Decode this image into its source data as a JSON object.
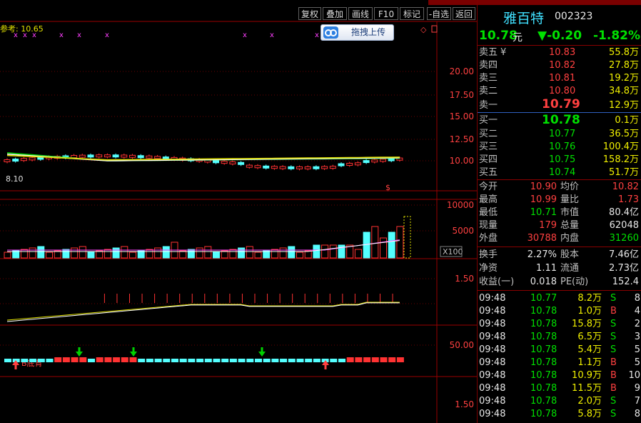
{
  "toolbar": {
    "buttons": [
      "复权",
      "叠加",
      "画线",
      "F10",
      "标记",
      "-自选",
      "返回"
    ]
  },
  "chart": {
    "ref_label": "参考: 10.65",
    "low_label": "8.10",
    "price_axis": [
      "20.00",
      "17.50",
      "15.00",
      "12.50",
      "10.00"
    ],
    "volume_axis": [
      "10000",
      "5000"
    ],
    "volume_unit": "X100",
    "ind1_axis": "1.50",
    "ind2_axis": "50.00",
    "ind2_label": "B底背",
    "ind3_axis": "1.50",
    "upload_label": "拖拽上传",
    "colors": {
      "up": "#ff3232",
      "down": "#54ffff",
      "ma_green": "#00d000",
      "ma_white": "#ffffff",
      "ma_yellow": "#e0e000",
      "ma_purple": "#ff40ff"
    }
  },
  "quote": {
    "name": "雅百特",
    "code": "002323",
    "price": "10.78",
    "price_unit": "元",
    "change": "▼-0.20",
    "change_pct": "-1.82%"
  },
  "order_book": {
    "sells": [
      {
        "label": "卖五",
        "flag": "¥",
        "price": "10.83",
        "vol": "55.8万"
      },
      {
        "label": "卖四",
        "price": "10.82",
        "vol": "27.8万"
      },
      {
        "label": "卖三",
        "price": "10.81",
        "vol": "19.2万"
      },
      {
        "label": "卖二",
        "price": "10.80",
        "vol": "34.8万"
      },
      {
        "label": "卖一",
        "price": "10.79",
        "vol": "12.9万"
      }
    ],
    "buys": [
      {
        "label": "买一",
        "price": "10.78",
        "vol": "0.1万"
      },
      {
        "label": "买二",
        "price": "10.77",
        "vol": "36.5万"
      },
      {
        "label": "买三",
        "price": "10.76",
        "vol": "100.4万"
      },
      {
        "label": "买四",
        "price": "10.75",
        "vol": "158.2万"
      },
      {
        "label": "买五",
        "price": "10.74",
        "vol": "51.7万"
      }
    ]
  },
  "stats": [
    {
      "l1": "今开",
      "v1": "10.90",
      "l2": "均价",
      "v2": "10.82"
    },
    {
      "l1": "最高",
      "v1": "10.99",
      "l2": "量比",
      "v2": "1.73"
    },
    {
      "l1": "最低",
      "v1": "10.71",
      "l2": "市值",
      "v2": "80.4亿"
    },
    {
      "l1": "现量",
      "v1": "179",
      "l2": "总量",
      "v2": "62048"
    },
    {
      "l1": "外盘",
      "v1": "30788",
      "l2": "内盘",
      "v2": "31260"
    }
  ],
  "fundamentals": [
    {
      "l1": "换手",
      "v1": "2.27%",
      "l2": "股本",
      "v2": "7.46亿"
    },
    {
      "l1": "净资",
      "v1": "1.11",
      "l2": "流通",
      "v2": "2.73亿"
    },
    {
      "l1": "收益(一)",
      "v1": "0.018",
      "l2": "PE(动)",
      "v2": "152.4"
    }
  ],
  "ticks": [
    {
      "time": "09:48",
      "price": "10.77",
      "vol": "8.2万",
      "side": "S",
      "n": "8"
    },
    {
      "time": "09:48",
      "price": "10.78",
      "vol": "1.0万",
      "side": "B",
      "n": "4"
    },
    {
      "time": "09:48",
      "price": "10.78",
      "vol": "15.8万",
      "side": "S",
      "n": "2"
    },
    {
      "time": "09:48",
      "price": "10.78",
      "vol": "6.5万",
      "side": "S",
      "n": "3"
    },
    {
      "time": "09:48",
      "price": "10.78",
      "vol": "5.4万",
      "side": "S",
      "n": "5"
    },
    {
      "time": "09:48",
      "price": "10.78",
      "vol": "1.1万",
      "side": "B",
      "n": "5"
    },
    {
      "time": "09:48",
      "price": "10.78",
      "vol": "10.9万",
      "side": "B",
      "n": "10"
    },
    {
      "time": "09:48",
      "price": "10.78",
      "vol": "11.5万",
      "side": "B",
      "n": "9"
    },
    {
      "time": "09:48",
      "price": "10.78",
      "vol": "2.0万",
      "side": "S",
      "n": "7"
    },
    {
      "time": "09:48",
      "price": "10.78",
      "vol": "5.8万",
      "side": "S",
      "n": "8"
    }
  ]
}
